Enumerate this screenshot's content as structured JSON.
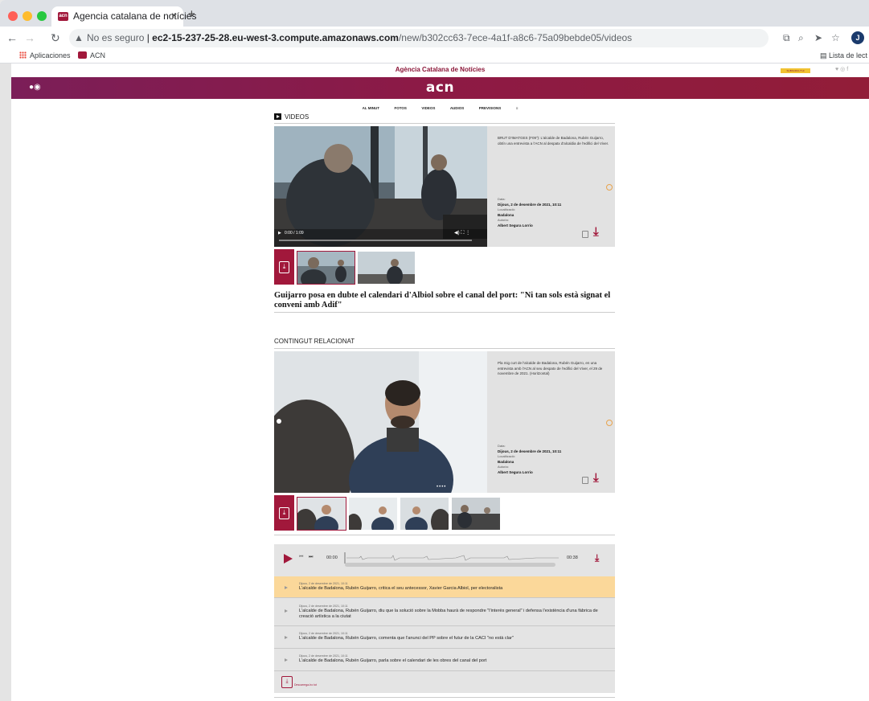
{
  "browser": {
    "tab_title": "Agencia catalana de notícies",
    "tab_close": "×",
    "new_tab": "+",
    "url_security": "No es seguro",
    "url_host": "ec2-15-237-25-28.eu-west-3.compute.amazonaws.com",
    "url_path": "/new/b302cc63-7ece-4a1f-a8c6-75a09bebde05/videos",
    "profile_initial": "J",
    "reading_list": "Lista de lect",
    "favicon_text": "acn",
    "bookmarks": [
      "Aplicaciones",
      "ACN"
    ]
  },
  "site": {
    "agency_title": "Agència Catalana de Notícies",
    "subscribe": "SUBSCRIU-T'HI",
    "logo": "acn",
    "nav": [
      "AL MINUT",
      "FOTOS",
      "VIDEOS",
      "AUDIOS",
      "PREVISIONS",
      "≡"
    ]
  },
  "videos": {
    "section_title": "VIDEOS",
    "time": "0:00 / 1:09",
    "description": "BRUT D'IMATGES (F09\"): L'alcalde de Badalona, Rubén Guijarro, obtín una entrevista a l'ACN al despatx d'alcaldia de l'edifici del Viver.",
    "date_label": "Data:",
    "date_value": "Dijous, 2 de desembre de 2021, 10:11",
    "location_label": "Localització:",
    "location_value": "Badalona",
    "author_label": "Autoria:",
    "author_value": "Albert Segura Lorrio",
    "headline": "Guijarro posa en dubte el calendari d'Albiol sobre el canal del port: \"Ni tan sols està signat el conveni amb Adif\""
  },
  "related": {
    "section_title": "CONTINGUT RELACIONAT",
    "description": "Pla mig curt de l'alcalde de Badalona, Rubén Guijarro, en una entrevista amb l'ACN al seu despatx de l'edifici del Viver, el 29 de novembre de 2021. (Horitzontal)",
    "date_label": "Data:",
    "date_value": "Dijous, 2 de desembre de 2021, 10:11",
    "location_label": "Localització:",
    "location_value": "Badalona",
    "author_label": "Autoria:",
    "author_value": "Albert Segura Lorrio"
  },
  "audio": {
    "time_start": "00:00",
    "time_end": "00:38",
    "progress": 0.0,
    "items": [
      {
        "date": "Dijous, 2 de desembre de 2021, 10:11",
        "title": "L'alcalde de Badalona, Rubén Guijarro, critica el seu antecessor, Xavier Garcia Albiol, per electoralista"
      },
      {
        "date": "Dijous, 2 de desembre de 2021, 10:11",
        "title": "L'alcalde de Badalona, Rubén Guijarro, diu que la solució sobre la Mobba haurà de respondre \"l'interès general\" i defensa l'existència d'una fàbrica de creació artística a la ciutat"
      },
      {
        "date": "Dijous, 2 de desembre de 2021, 10:11",
        "title": "L'alcalde de Badalona, Rubén Guijarro, comenta que l'anunci del PP sobre el futur de la CACI \"no està clar\""
      },
      {
        "date": "Dijous, 2 de desembre de 2021, 10:11",
        "title": "L'alcalde de Badalona, Rubén Guijarro, parla sobre el calendari de les obres del canal del port"
      }
    ],
    "download_all": "Descarrega-ho tot"
  },
  "colors": {
    "brand": "#a1183b",
    "header_gradient_start": "#7b1e58",
    "active_item": "#fbd89a",
    "subscribe_bg": "#f1c232"
  }
}
